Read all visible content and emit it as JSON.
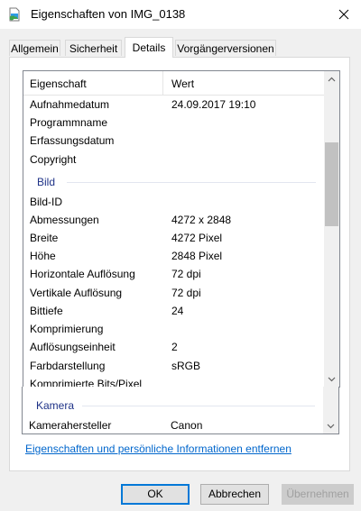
{
  "window": {
    "title": "Eigenschaften von IMG_0138"
  },
  "tabs": [
    "Allgemein",
    "Sicherheit",
    "Details",
    "Vorgängerversionen"
  ],
  "active_tab": "Details",
  "table": {
    "col1": "Eigenschaft",
    "col2": "Wert"
  },
  "rows": [
    {
      "k": "Aufnahmedatum",
      "v": "24.09.2017 19:10"
    },
    {
      "k": "Programmname",
      "v": ""
    },
    {
      "k": "Erfassungsdatum",
      "v": ""
    },
    {
      "k": "Copyright",
      "v": ""
    }
  ],
  "groups": {
    "bild": "Bild",
    "kamera": "Kamera"
  },
  "bild_rows": [
    {
      "k": "Bild-ID",
      "v": ""
    },
    {
      "k": "Abmessungen",
      "v": "4272 x 2848"
    },
    {
      "k": "Breite",
      "v": "4272 Pixel"
    },
    {
      "k": "Höhe",
      "v": "2848 Pixel"
    },
    {
      "k": "Horizontale Auflösung",
      "v": "72 dpi"
    },
    {
      "k": "Vertikale Auflösung",
      "v": "72 dpi"
    },
    {
      "k": "Bittiefe",
      "v": "24"
    },
    {
      "k": "Komprimierung",
      "v": ""
    },
    {
      "k": "Auflösungseinheit",
      "v": "2"
    },
    {
      "k": "Farbdarstellung",
      "v": "sRGB"
    },
    {
      "k": "Komprimierte Bits/Pixel",
      "v": ""
    }
  ],
  "kamera_rows": [
    {
      "k": "Kamerahersteller",
      "v": "Canon"
    }
  ],
  "remove_link": "Eigenschaften und persönliche Informationen entfernen",
  "buttons": {
    "ok": "OK",
    "cancel": "Abbrechen",
    "apply": "Übernehmen"
  },
  "colors": {
    "accent": "#0078d7",
    "link": "#0066cc",
    "group": "#1e3287"
  },
  "icons": {
    "app": "photo-file-icon",
    "close": "close-icon",
    "scroll_up": "chevron-up-icon",
    "scroll_down": "chevron-down-icon"
  }
}
